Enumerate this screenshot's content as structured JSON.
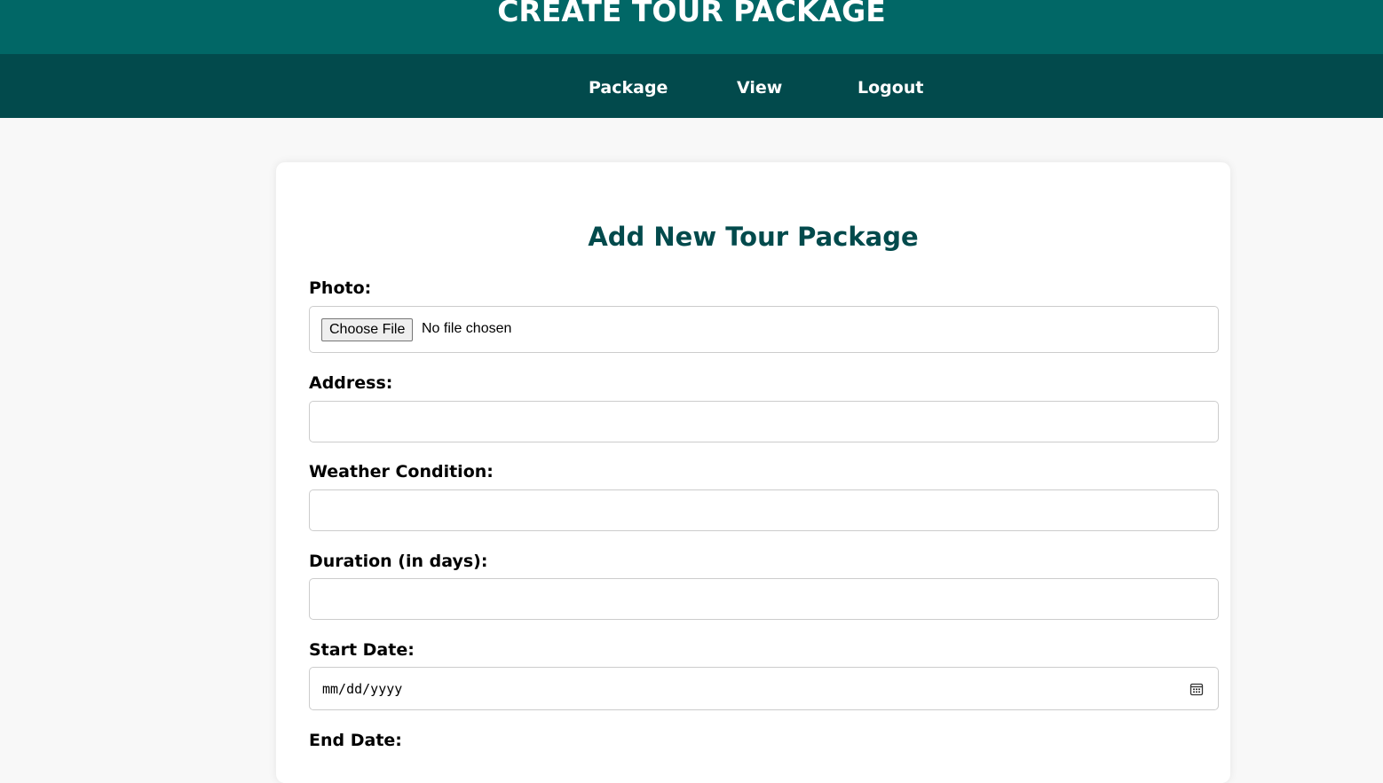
{
  "header": {
    "title": "CREATE TOUR PACKAGE"
  },
  "nav": {
    "items": [
      {
        "label": "Package"
      },
      {
        "label": "View"
      },
      {
        "label": "Logout"
      }
    ]
  },
  "form": {
    "title": "Add New Tour Package",
    "photo": {
      "label": "Photo:",
      "button_label": "Choose File",
      "status_text": "No file chosen"
    },
    "address": {
      "label": "Address:",
      "value": ""
    },
    "weather": {
      "label": "Weather Condition:",
      "value": ""
    },
    "duration": {
      "label": "Duration (in days):",
      "value": ""
    },
    "start_date": {
      "label": "Start Date:",
      "placeholder": "mm/dd/yyyy",
      "icon": "calendar-icon"
    },
    "end_date": {
      "label": "End Date:"
    }
  },
  "colors": {
    "header_bg": "#016766",
    "nav_bg": "#024a4c",
    "title_text": "#024a4c",
    "page_bg": "#f8f8f8"
  }
}
